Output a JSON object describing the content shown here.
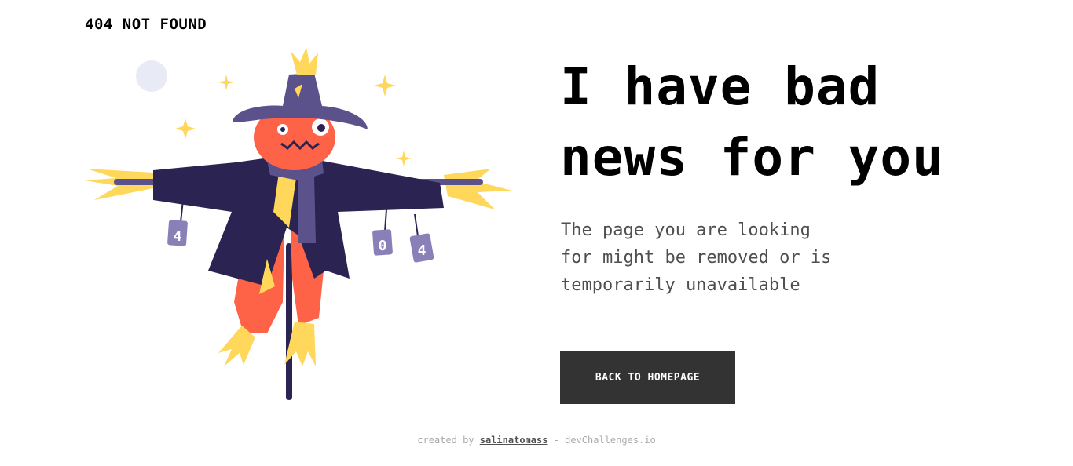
{
  "header": {
    "brand": "404 NOT FOUND"
  },
  "illustration": {
    "alt": "scarecrow",
    "can_labels": [
      "4",
      "0",
      "4"
    ],
    "colors": {
      "hat": "#5b528c",
      "coat": "#2b2452",
      "face": "#ff6347",
      "straw": "#ffd75a",
      "pole": "#2b2452",
      "moon": "#e8ebf5"
    }
  },
  "main": {
    "headline_line1": "I have bad",
    "headline_line2": "news for you",
    "subtext_line1": "The page you are looking",
    "subtext_line2": "for might be removed or is",
    "subtext_line3": "temporarily unavailable",
    "cta_label": "BACK TO HOMEPAGE"
  },
  "footer": {
    "prefix": "created by",
    "author": "salinatomass",
    "suffix": "- devChallenges.io"
  },
  "theme": {
    "button_bg": "#333333",
    "subtext_color": "#4f4f4f",
    "footer_color": "#a9a9a9"
  }
}
